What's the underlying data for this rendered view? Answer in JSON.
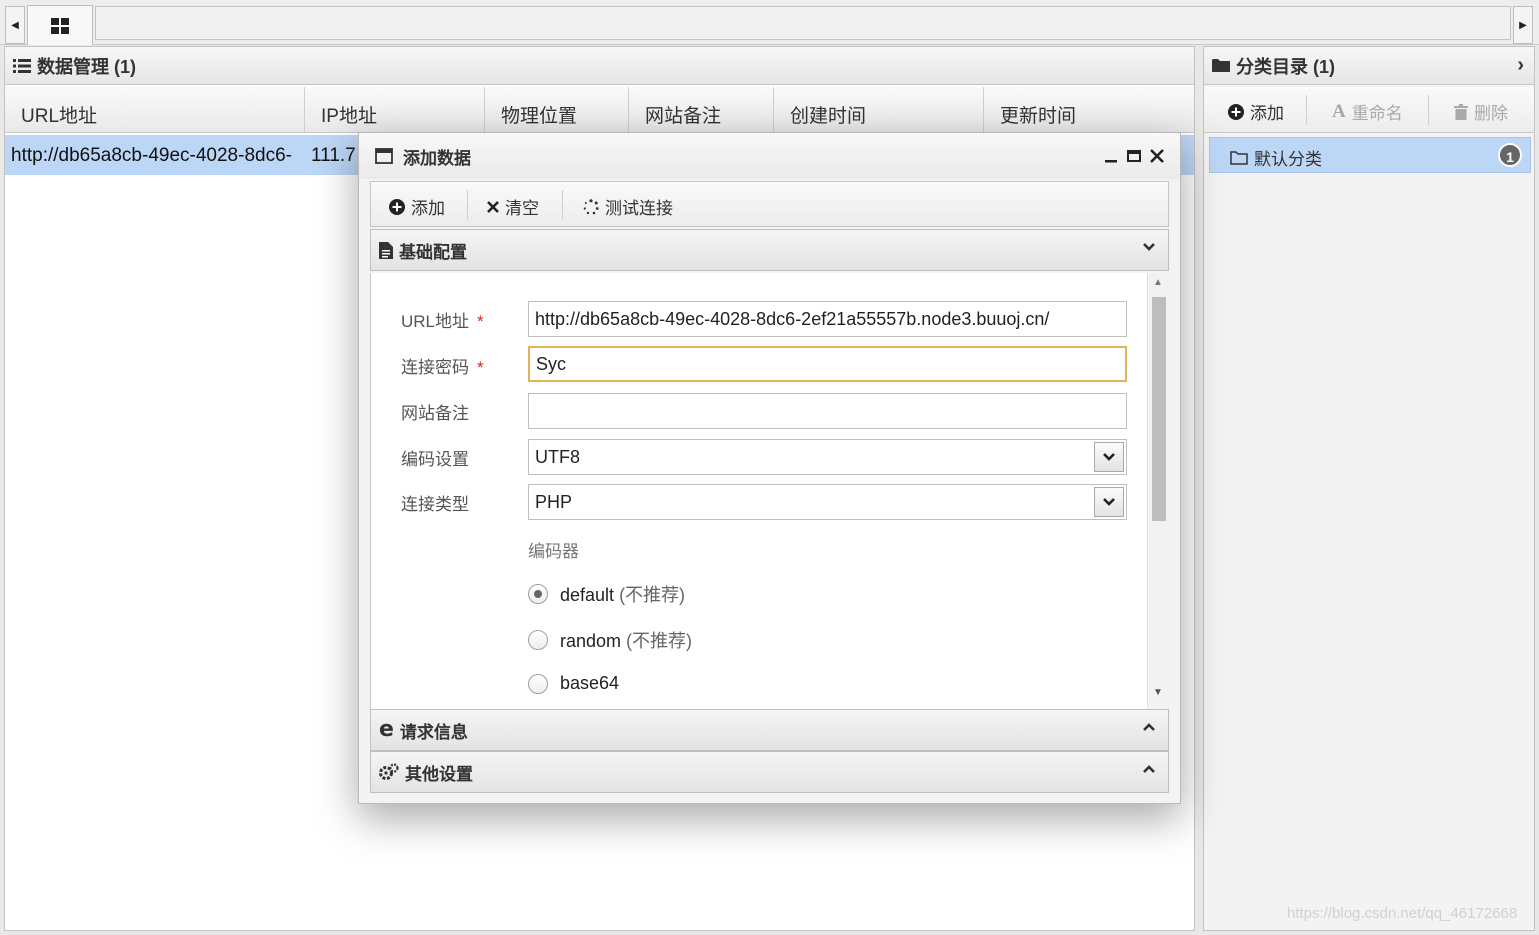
{
  "topbar": {
    "nav_left": "◀",
    "nav_right": "▶",
    "home_tab_icon": "grid-icon"
  },
  "data_panel": {
    "title": "数据管理 (1)",
    "columns": [
      "URL地址",
      "IP地址",
      "物理位置",
      "网站备注",
      "创建时间",
      "更新时间"
    ],
    "rows": [
      {
        "url": "http://db65a8cb-49ec-4028-8dc6-",
        "ip": "111.7"
      }
    ]
  },
  "category_panel": {
    "title": "分类目录 (1)",
    "toolbar": {
      "add": "添加",
      "rename": "重命名",
      "delete": "删除"
    },
    "items": [
      {
        "label": "默认分类",
        "count": "1"
      }
    ]
  },
  "dialog": {
    "title": "添加数据",
    "controls": {
      "minimize": "_",
      "maximize": "□",
      "close": "✕"
    },
    "toolbar": {
      "add": "添加",
      "clear": "清空",
      "test": "测试连接"
    },
    "sections": {
      "basic": "基础配置",
      "request": "请求信息",
      "other": "其他设置"
    },
    "form": {
      "url_label": "URL地址",
      "url_value": "http://db65a8cb-49ec-4028-8dc6-2ef21a55557b.node3.buuoj.cn/",
      "password_label": "连接密码",
      "password_value": "Syc",
      "note_label": "网站备注",
      "note_value": "",
      "encoding_label": "编码设置",
      "encoding_value": "UTF8",
      "type_label": "连接类型",
      "type_value": "PHP",
      "required_mark": "*",
      "encoder_label": "编码器",
      "encoders": [
        {
          "name": "default",
          "note": "(不推荐)",
          "selected": true
        },
        {
          "name": "random",
          "note": "(不推荐)",
          "selected": false
        },
        {
          "name": "base64",
          "note": "",
          "selected": false
        }
      ]
    }
  },
  "watermark": "https://blog.csdn.net/qq_46172668",
  "colors": {
    "selection": "#bcd6f5",
    "focus_border": "#e2b35b",
    "required": "#e02020"
  }
}
